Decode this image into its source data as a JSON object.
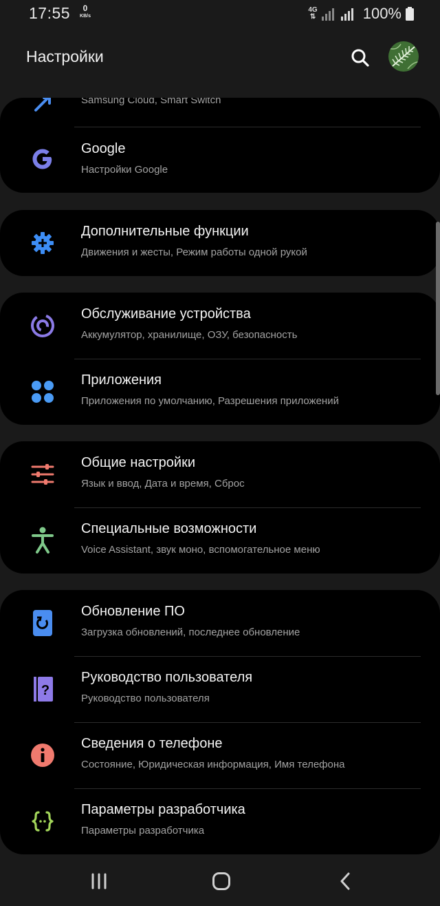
{
  "status_bar": {
    "time": "17:55",
    "speed_value": "0",
    "speed_unit": "KB/s",
    "network_type": "4G",
    "battery": "100%"
  },
  "header": {
    "title": "Настройки"
  },
  "cards": [
    {
      "items": [
        {
          "title": "",
          "subtitle": "Samsung Cloud, Smart Switch",
          "icon": "cloud-sync-icon",
          "color": "#4a8df0"
        },
        {
          "title": "Google",
          "subtitle": "Настройки Google",
          "icon": "google-icon",
          "color": "#7b7fe8"
        }
      ]
    },
    {
      "items": [
        {
          "title": "Дополнительные функции",
          "subtitle": "Движения и жесты, Режим работы одной рукой",
          "icon": "gear-plus-icon",
          "color": "#3d8df5"
        }
      ]
    },
    {
      "items": [
        {
          "title": "Обслуживание устройства",
          "subtitle": "Аккумулятор, хранилище, ОЗУ, безопасность",
          "icon": "device-care-icon",
          "color": "#8b7ae6"
        },
        {
          "title": "Приложения",
          "subtitle": "Приложения по умолчанию, Разрешения приложений",
          "icon": "apps-grid-icon",
          "color": "#4a9bf5"
        }
      ]
    },
    {
      "items": [
        {
          "title": "Общие настройки",
          "subtitle": "Язык и ввод, Дата и время, Сброс",
          "icon": "sliders-icon",
          "color": "#f07a6e"
        },
        {
          "title": "Специальные возможности",
          "subtitle": "Voice Assistant, звук моно, вспомогательное меню",
          "icon": "accessibility-icon",
          "color": "#7fc98a"
        }
      ]
    },
    {
      "items": [
        {
          "title": "Обновление ПО",
          "subtitle": "Загрузка обновлений, последнее обновление",
          "icon": "software-update-icon",
          "color": "#4a8df0"
        },
        {
          "title": "Руководство пользователя",
          "subtitle": "Руководство пользователя",
          "icon": "user-manual-icon",
          "color": "#8e7ae8"
        },
        {
          "title": "Сведения о телефоне",
          "subtitle": "Состояние, Юридическая информация, Имя телефона",
          "icon": "info-icon",
          "color": "#f07a6e"
        },
        {
          "title": "Параметры разработчика",
          "subtitle": "Параметры разработчика",
          "icon": "braces-icon",
          "color": "#a3d65a"
        }
      ]
    }
  ]
}
